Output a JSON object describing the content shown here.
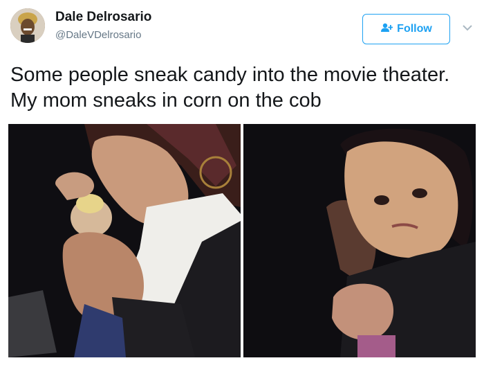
{
  "author": {
    "display_name": "Dale Delrosario",
    "handle": "@DaleVDelrosario"
  },
  "follow_button": {
    "label": "Follow",
    "icon": "add-user-icon"
  },
  "menu": {
    "icon": "chevron-down-icon"
  },
  "tweet": {
    "text": "Some people sneak candy into the movie theater. My mom sneaks in corn on the cob"
  },
  "colors": {
    "accent": "#1da1f2",
    "text": "#14171a",
    "secondary": "#657786"
  }
}
